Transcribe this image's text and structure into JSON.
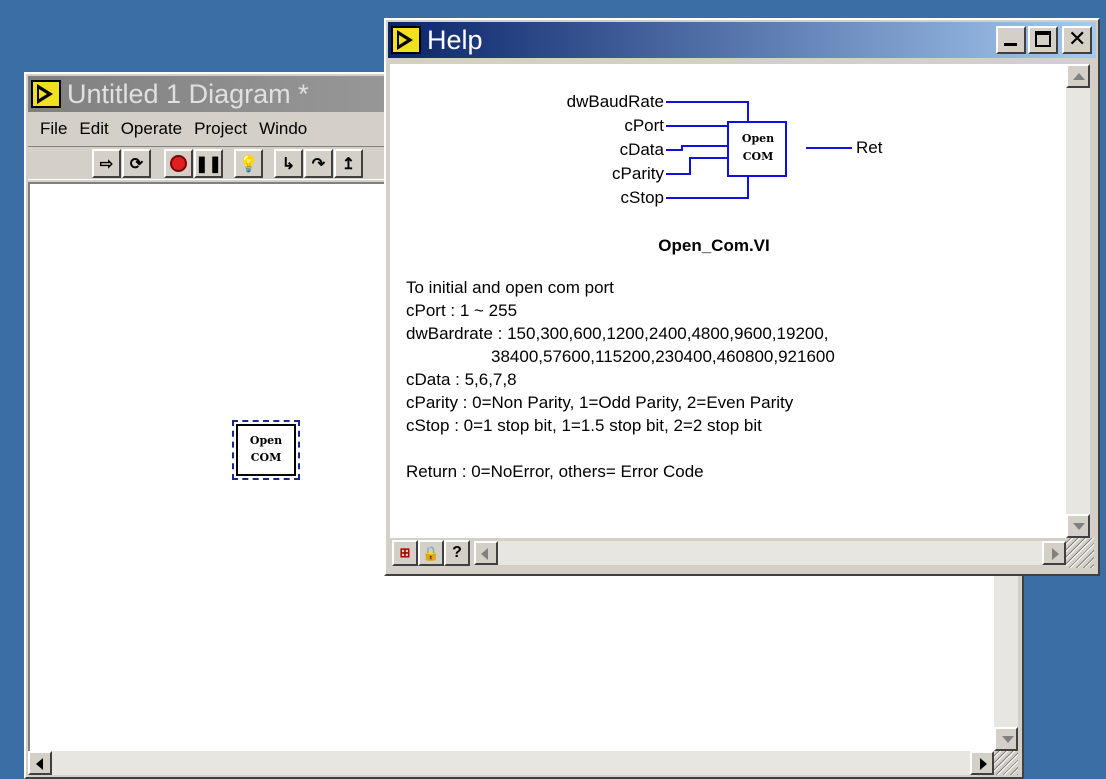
{
  "diagram_window": {
    "title": "Untitled 1 Diagram *",
    "menu": [
      "File",
      "Edit",
      "Operate",
      "Project",
      "Windo"
    ],
    "node_label": [
      "Open",
      "COM"
    ]
  },
  "help_window": {
    "title": "Help",
    "connector": {
      "inputs": [
        "dwBaudRate",
        "cPort",
        "cData",
        "cParity",
        "cStop"
      ],
      "output": "Ret",
      "icon_text": [
        "Open",
        "COM"
      ]
    },
    "vi_name": "Open_Com.VI",
    "description_lines": [
      "To initial and open com port",
      "cPort : 1 ~ 255",
      "dwBardrate : 150,300,600,1200,2400,4800,9600,19200,",
      "                  38400,57600,115200,230400,460800,921600",
      "cData : 5,6,7,8",
      "cParity : 0=Non Parity, 1=Odd Parity, 2=Even Parity",
      "cStop : 0=1 stop bit, 1=1.5 stop bit, 2=2 stop bit",
      "",
      "Return : 0=NoError, others= Error Code"
    ]
  },
  "colors": {
    "desktop": "#3a6ea5",
    "active_title": "#0a246a",
    "wire": "#1010e0"
  }
}
